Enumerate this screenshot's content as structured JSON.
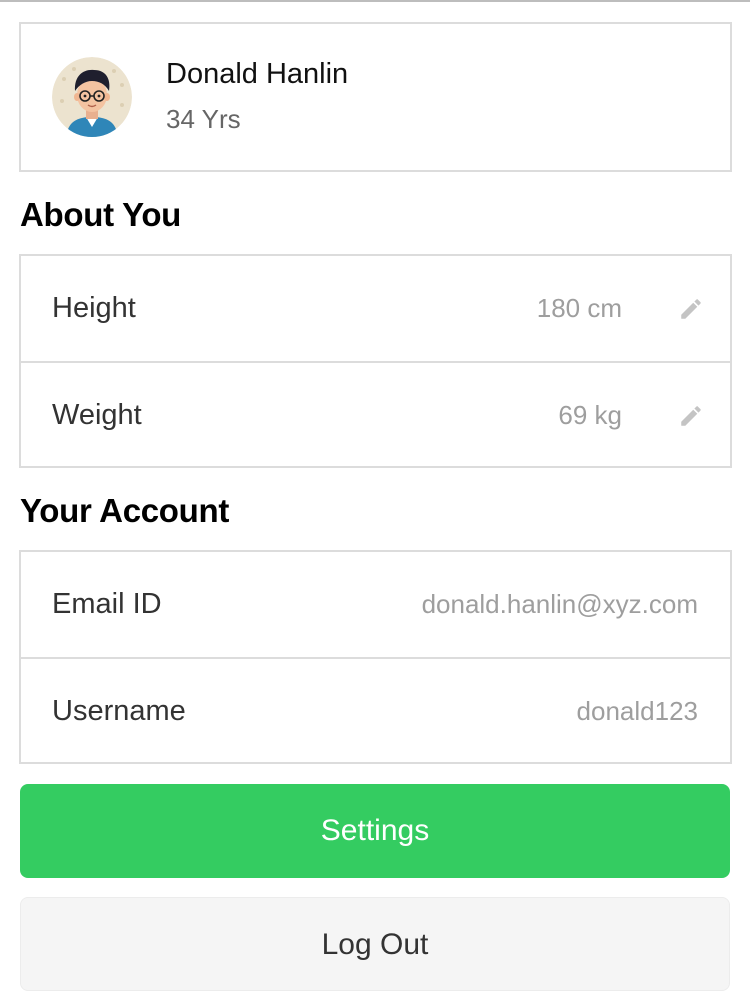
{
  "profile": {
    "name": "Donald Hanlin",
    "age": "34 Yrs",
    "avatar_icon": "user-avatar-illustration"
  },
  "about": {
    "title": "About You",
    "rows": [
      {
        "label": "Height",
        "value": "180 cm",
        "icon": "pencil-icon"
      },
      {
        "label": "Weight",
        "value": "69 kg",
        "icon": "pencil-icon"
      }
    ]
  },
  "account": {
    "title": "Your Account",
    "rows": [
      {
        "label": "Email ID",
        "value": "donald.hanlin@xyz.com"
      },
      {
        "label": "Username",
        "value": "donald123"
      }
    ]
  },
  "actions": {
    "settings_label": "Settings",
    "logout_label": "Log Out"
  },
  "colors": {
    "accent": "#34cc61",
    "secondary_button": "#f5f5f5",
    "border": "#dcdcdc",
    "value_text": "#9e9e9e"
  }
}
